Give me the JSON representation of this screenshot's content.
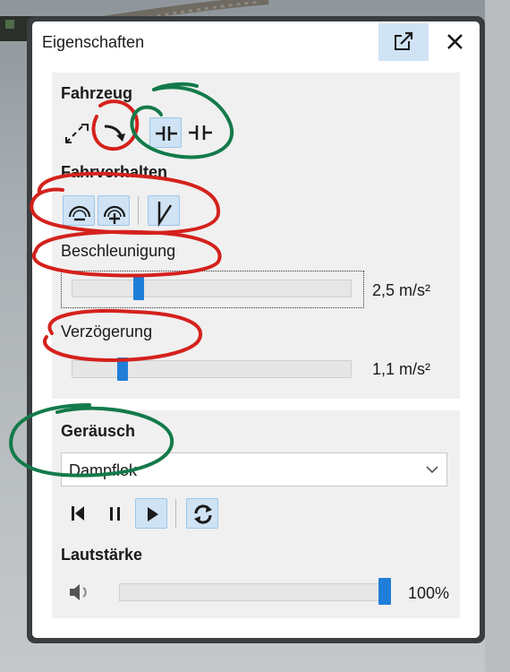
{
  "window": {
    "title": "Eigenschaften"
  },
  "vehicle": {
    "heading": "Fahrzeug",
    "icons": [
      "expand-arrows-icon",
      "turn-arrow-icon",
      "coupling-icon",
      "uncoupling-icon"
    ]
  },
  "behavior": {
    "heading": "Fahrverhalten",
    "icons": [
      "speedometer-minus-icon",
      "speedometer-plus-icon",
      "ramp-icon"
    ]
  },
  "acceleration": {
    "label": "Beschleunigung",
    "value": "2,5 m/s²",
    "level": 0.23
  },
  "deceleration": {
    "label": "Verzögerung",
    "value": "1,1 m/s²",
    "level": 0.17
  },
  "sound": {
    "heading": "Geräusch",
    "selected": "Dampflok",
    "controls": [
      "skip-back-icon",
      "pause-icon",
      "play-icon",
      "loop-icon"
    ]
  },
  "volume": {
    "label": "Lautstärke",
    "value": "100%",
    "level": 1.0
  },
  "colors": {
    "accent": "#1f7fd8",
    "selected_bg": "#cfe3f5",
    "annotation_red": "#d4211c",
    "annotation_green": "#137a4a"
  }
}
